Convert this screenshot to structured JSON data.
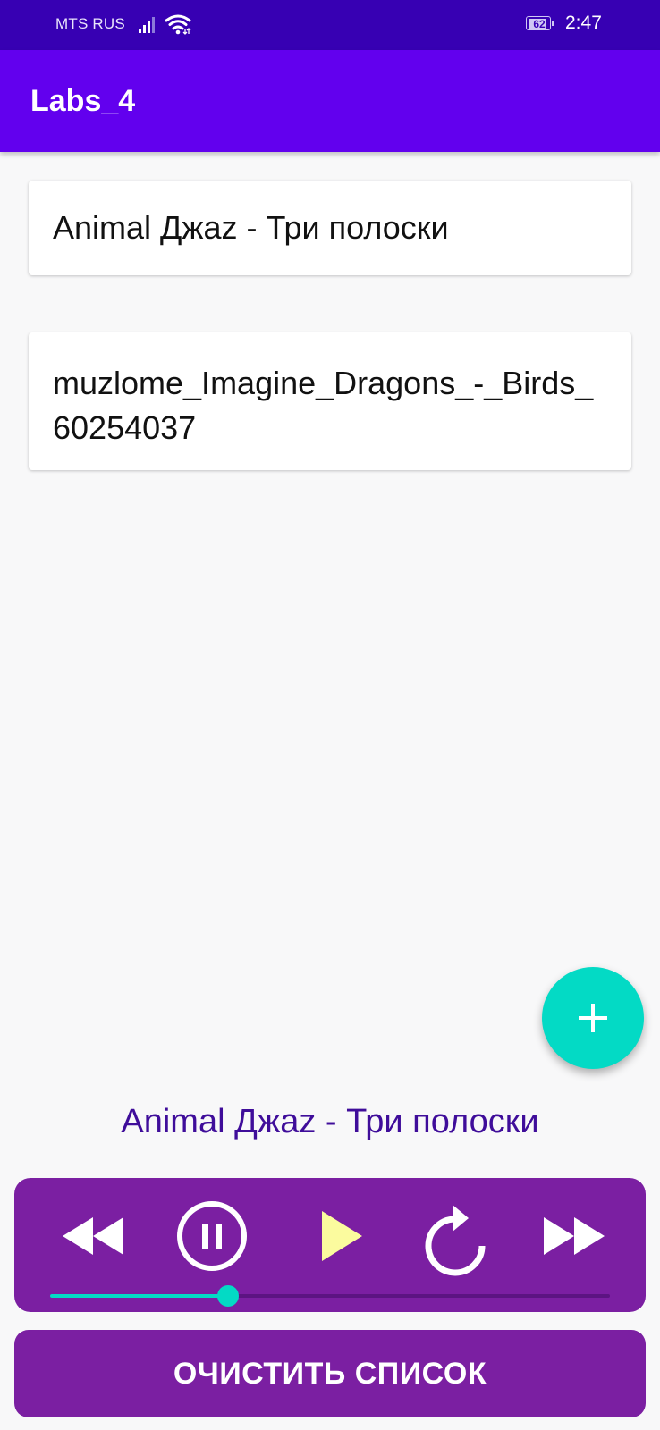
{
  "status_bar": {
    "carrier": "MTS RUS",
    "battery_level": "62",
    "time": "2:47"
  },
  "app_bar": {
    "title": "Labs_4"
  },
  "tracks": [
    {
      "title": "Animal Джаz - Три полоски"
    },
    {
      "title": "muzlome_Imagine_Dragons_-_Birds_60254037"
    }
  ],
  "fab": {
    "icon": "plus-icon",
    "color": "#03dac5"
  },
  "player": {
    "now_playing": "Animal Джаz - Три полоски",
    "progress": 0.318,
    "controls": [
      "rewind-icon",
      "pause-circle-icon",
      "play-icon",
      "replay-icon",
      "fast-forward-icon"
    ],
    "play_icon_color": "#fbfb9e",
    "panel_color": "#7b1fa2",
    "accent_color": "#03dac5"
  },
  "clear_button": {
    "label": "ОЧИСТИТЬ СПИСОК"
  },
  "colors": {
    "status_bar": "#3700b3",
    "app_bar": "#6200ee",
    "now_playing_text": "#3f0d9a"
  }
}
